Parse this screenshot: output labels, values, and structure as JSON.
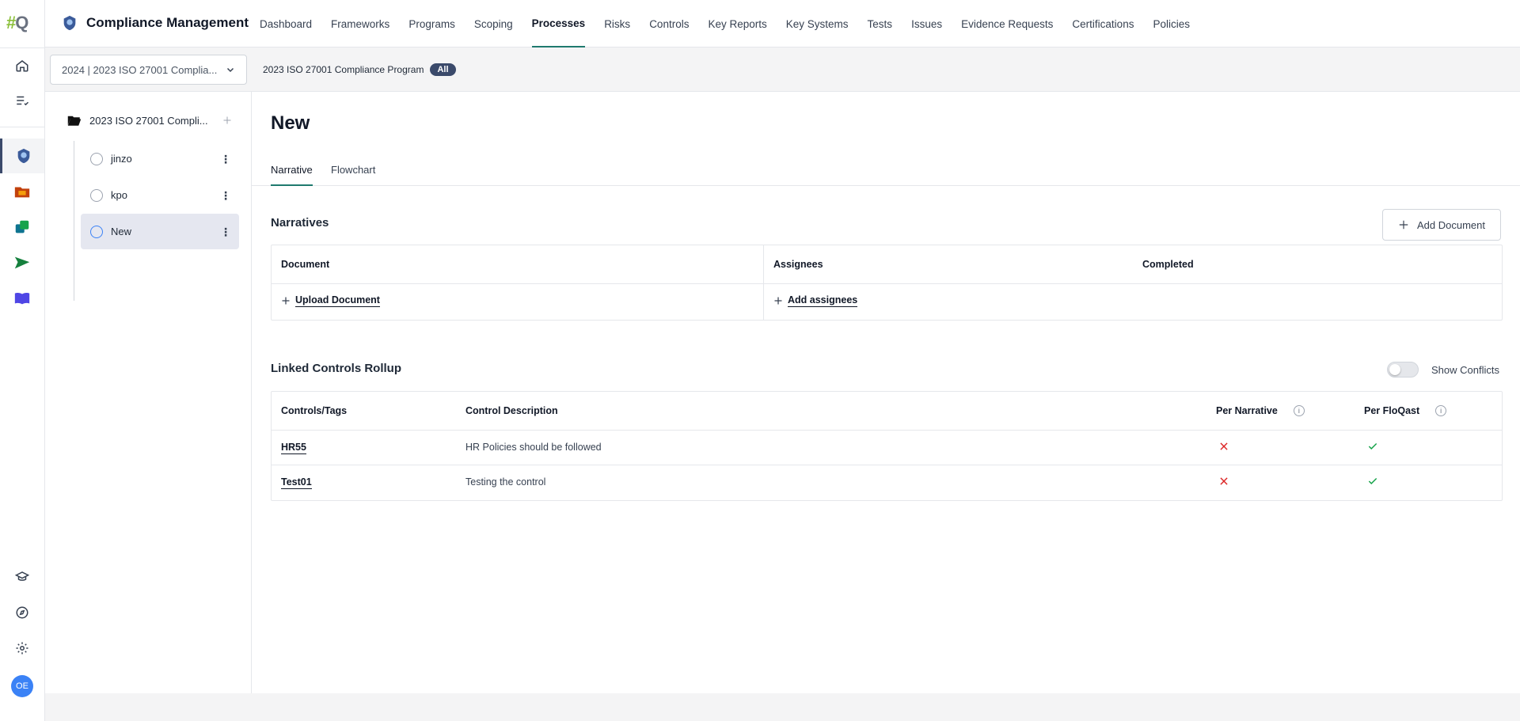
{
  "app": {
    "logo_hash": "#",
    "logo_q": "Q",
    "title": "Compliance Management",
    "user_initials": "OE"
  },
  "nav": {
    "items": [
      {
        "label": "Dashboard"
      },
      {
        "label": "Frameworks"
      },
      {
        "label": "Programs"
      },
      {
        "label": "Scoping"
      },
      {
        "label": "Processes",
        "active": true
      },
      {
        "label": "Risks"
      },
      {
        "label": "Controls"
      },
      {
        "label": "Key Reports"
      },
      {
        "label": "Key Systems"
      },
      {
        "label": "Tests"
      },
      {
        "label": "Issues"
      },
      {
        "label": "Evidence Requests"
      },
      {
        "label": "Certifications"
      },
      {
        "label": "Policies"
      }
    ]
  },
  "subbar": {
    "program_select": "2024 | 2023 ISO 27001 Complia...",
    "program_name": "2023 ISO 27001 Compliance Program",
    "filter_pill": "All"
  },
  "tree": {
    "root_label": "2023 ISO 27001 Compli...",
    "items": [
      {
        "label": "jinzo"
      },
      {
        "label": "kpo"
      },
      {
        "label": "New",
        "selected": true
      }
    ]
  },
  "main": {
    "title": "New",
    "tabs": [
      {
        "label": "Narrative",
        "active": true
      },
      {
        "label": "Flowchart"
      }
    ],
    "narratives": {
      "title": "Narratives",
      "add_button": "Add Document",
      "headers": {
        "document": "Document",
        "assignees": "Assignees",
        "completed": "Completed"
      },
      "upload_label": "Upload Document",
      "add_assignees_label": "Add assignees"
    },
    "rollup": {
      "title": "Linked Controls Rollup",
      "toggle_label": "Show Conflicts",
      "headers": {
        "controls": "Controls/Tags",
        "description": "Control Description",
        "per_narrative": "Per Narrative",
        "per_floqast": "Per FloQast"
      },
      "rows": [
        {
          "control": "HR55",
          "description": "HR Policies should be followed",
          "per_narrative": "no",
          "per_floqast": "yes"
        },
        {
          "control": "Test01",
          "description": "Testing the control",
          "per_narrative": "no",
          "per_floqast": "yes"
        }
      ]
    }
  },
  "colors": {
    "accent": "#1f7a6e",
    "cross": "#dc2626",
    "check": "#16a34a",
    "selected_bg": "#e5e7f0"
  }
}
